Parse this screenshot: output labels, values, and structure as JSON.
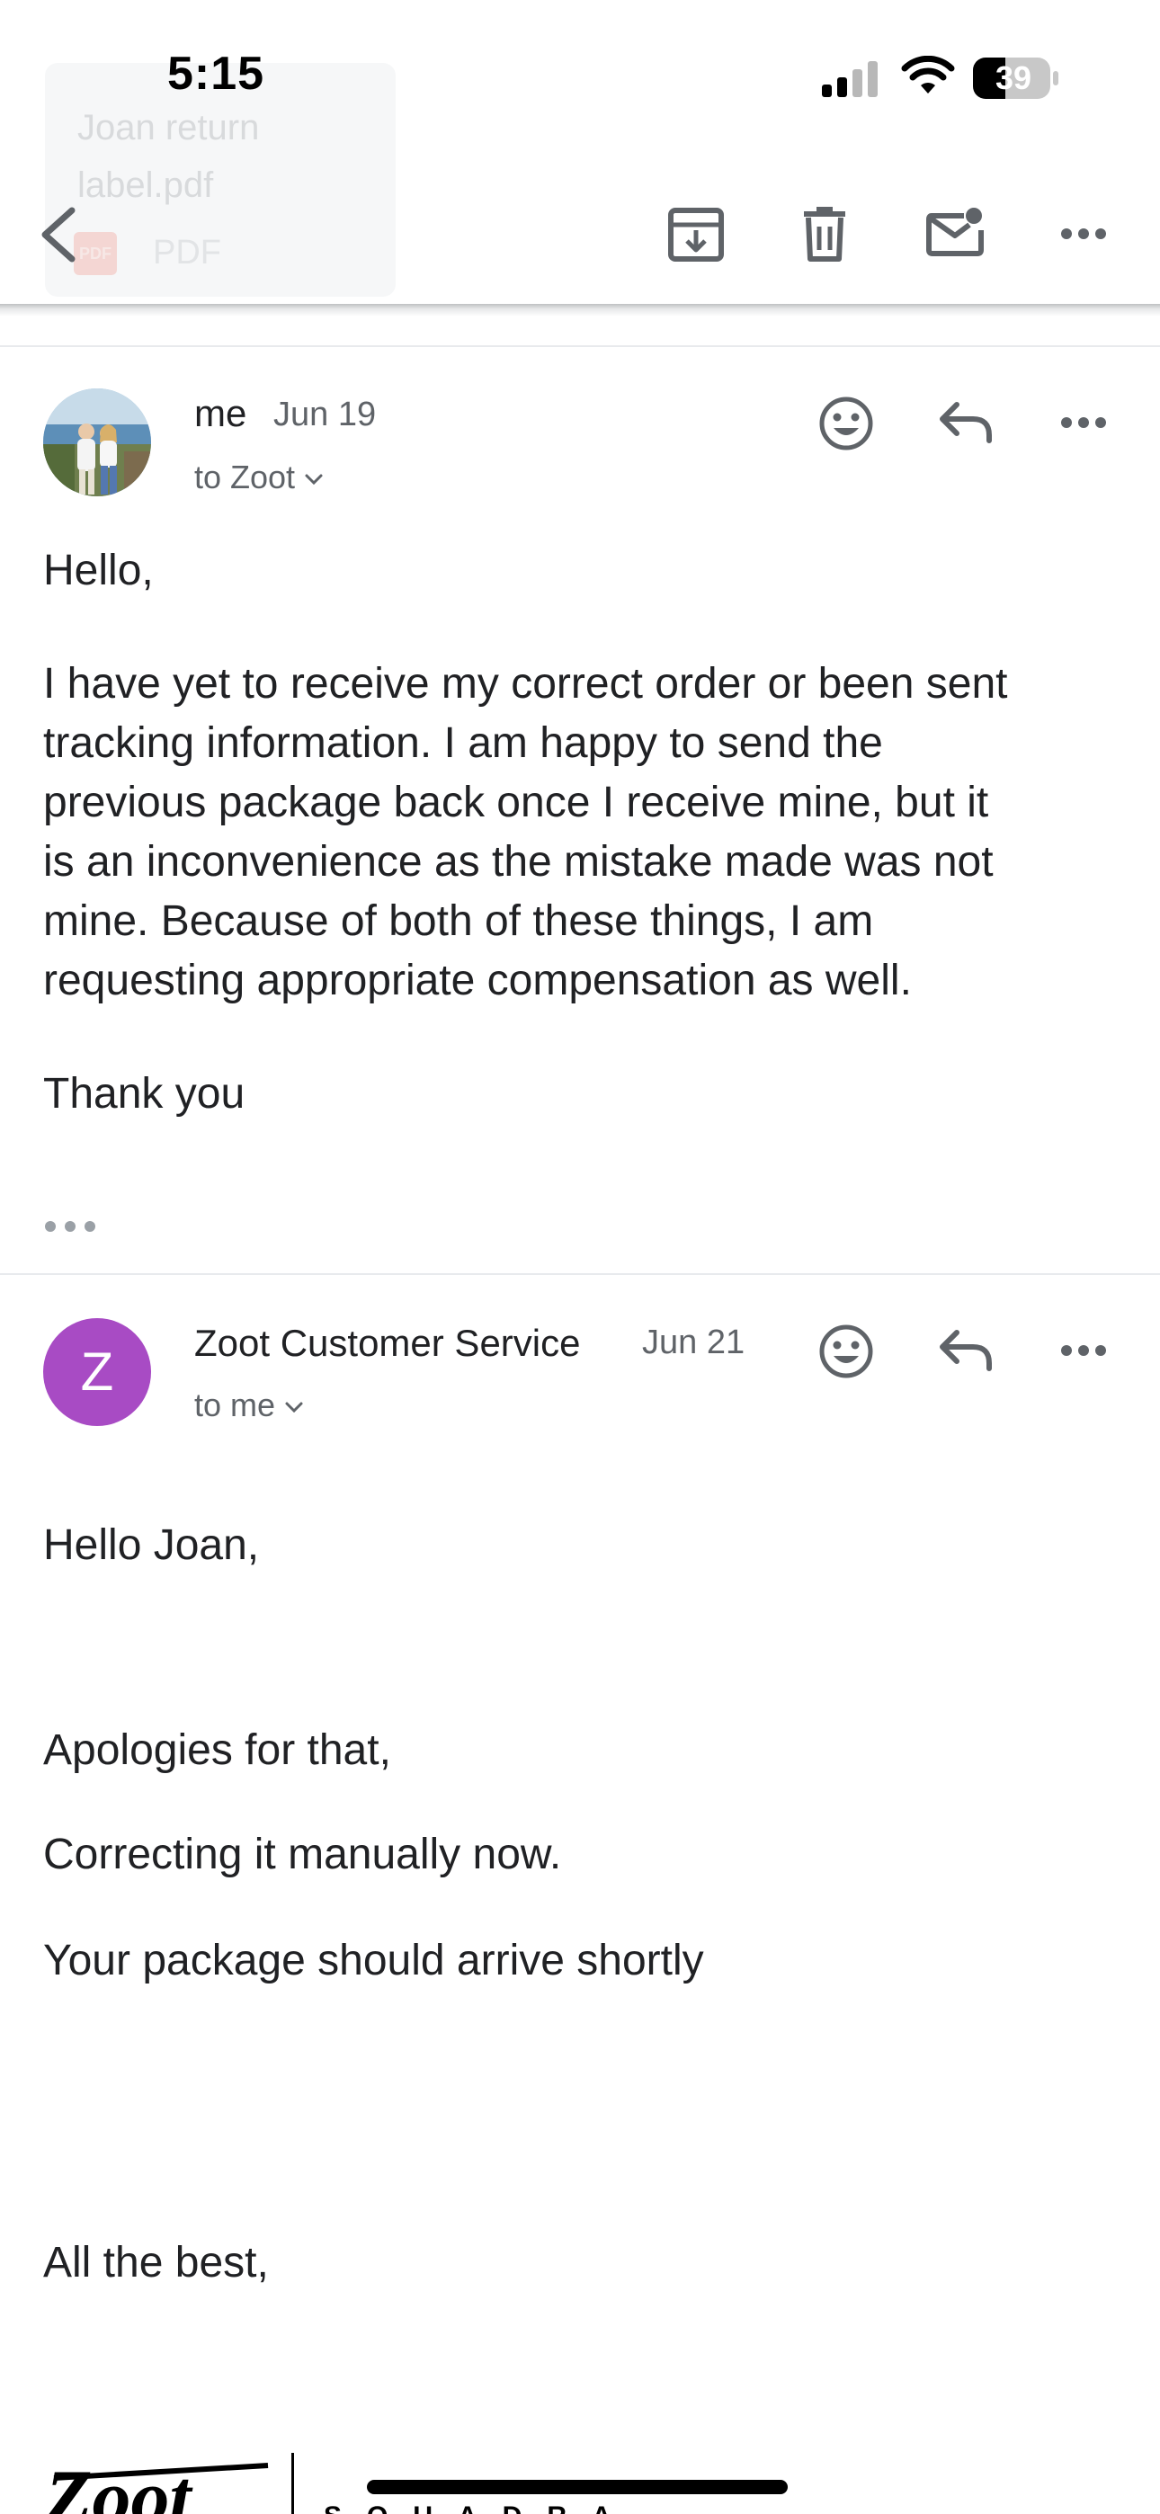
{
  "status_bar": {
    "time": "5:15",
    "battery": "39"
  },
  "attachment_ghost": {
    "name": "Joan return label.pdf",
    "type": "PDF"
  },
  "toolbar": {
    "back": "back-icon",
    "archive": "archive-icon",
    "delete": "trash-icon",
    "mark_unread": "mail-unread-icon",
    "more": "more-icon"
  },
  "messages": [
    {
      "sender": "me",
      "date": "Jun 19",
      "recipient": "to Zoot",
      "body": [
        "Hello,",
        "I have yet to receive my correct order or been sent",
        "tracking information. I am happy to send the",
        "previous package back once I receive mine, but it",
        "is an inconvenience as the mistake made was not",
        "mine. Because of both of these things, I am",
        "requesting appropriate compensation as well.",
        "Thank you"
      ]
    },
    {
      "sender": "Zoot Customer Service",
      "avatar_letter": "Z",
      "date": "Jun 21",
      "recipient": "to me",
      "body": [
        "Hello Joan,",
        "Apologies for that,",
        "Correcting it manually now.",
        "Your package should arrive shortly",
        "All the best,"
      ]
    }
  ],
  "signature": {
    "brand": "Zoot",
    "tagline": "SQUADRA"
  },
  "colors": {
    "avatar_z": "#a84bc4",
    "icon_gray": "#5f6368",
    "text": "#202124"
  }
}
